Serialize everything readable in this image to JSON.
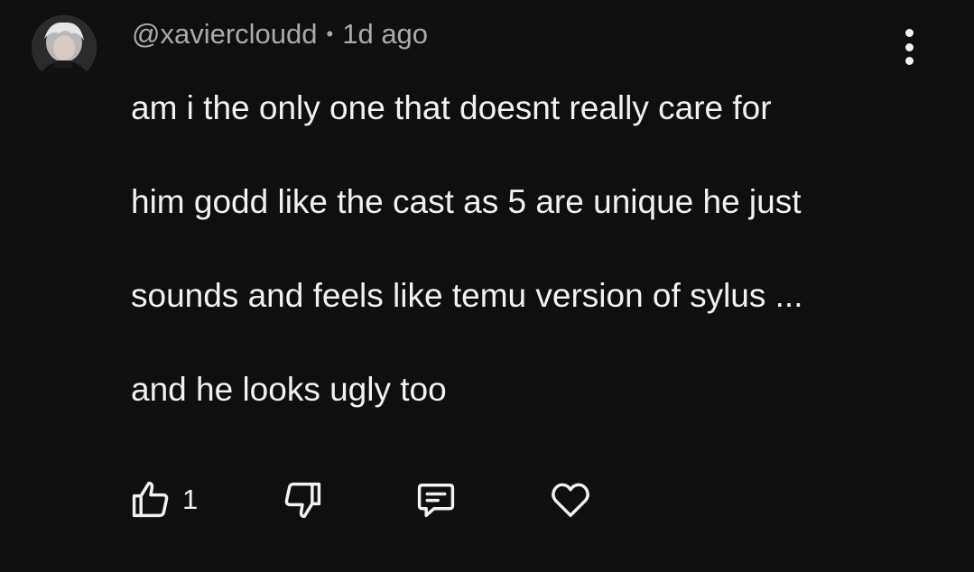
{
  "comment": {
    "author": "@xaviercloudd",
    "separator": "•",
    "timestamp": "1d ago",
    "lines": [
      "am i the only one that doesnt really care for",
      "him godd like the cast as 5 are unique he just",
      "sounds and feels like temu version of sylus ...",
      "and he looks ugly too"
    ],
    "like_count": "1"
  },
  "icons": {
    "avatar": "user-avatar",
    "more": "more-vert-icon",
    "like": "thumb-up-icon",
    "dislike": "thumb-down-icon",
    "reply": "reply-comment-icon",
    "heart": "heart-icon"
  },
  "colors": {
    "background": "#0f0f0f",
    "text_primary": "#f1f1f1",
    "text_secondary": "#aaaaaa"
  }
}
